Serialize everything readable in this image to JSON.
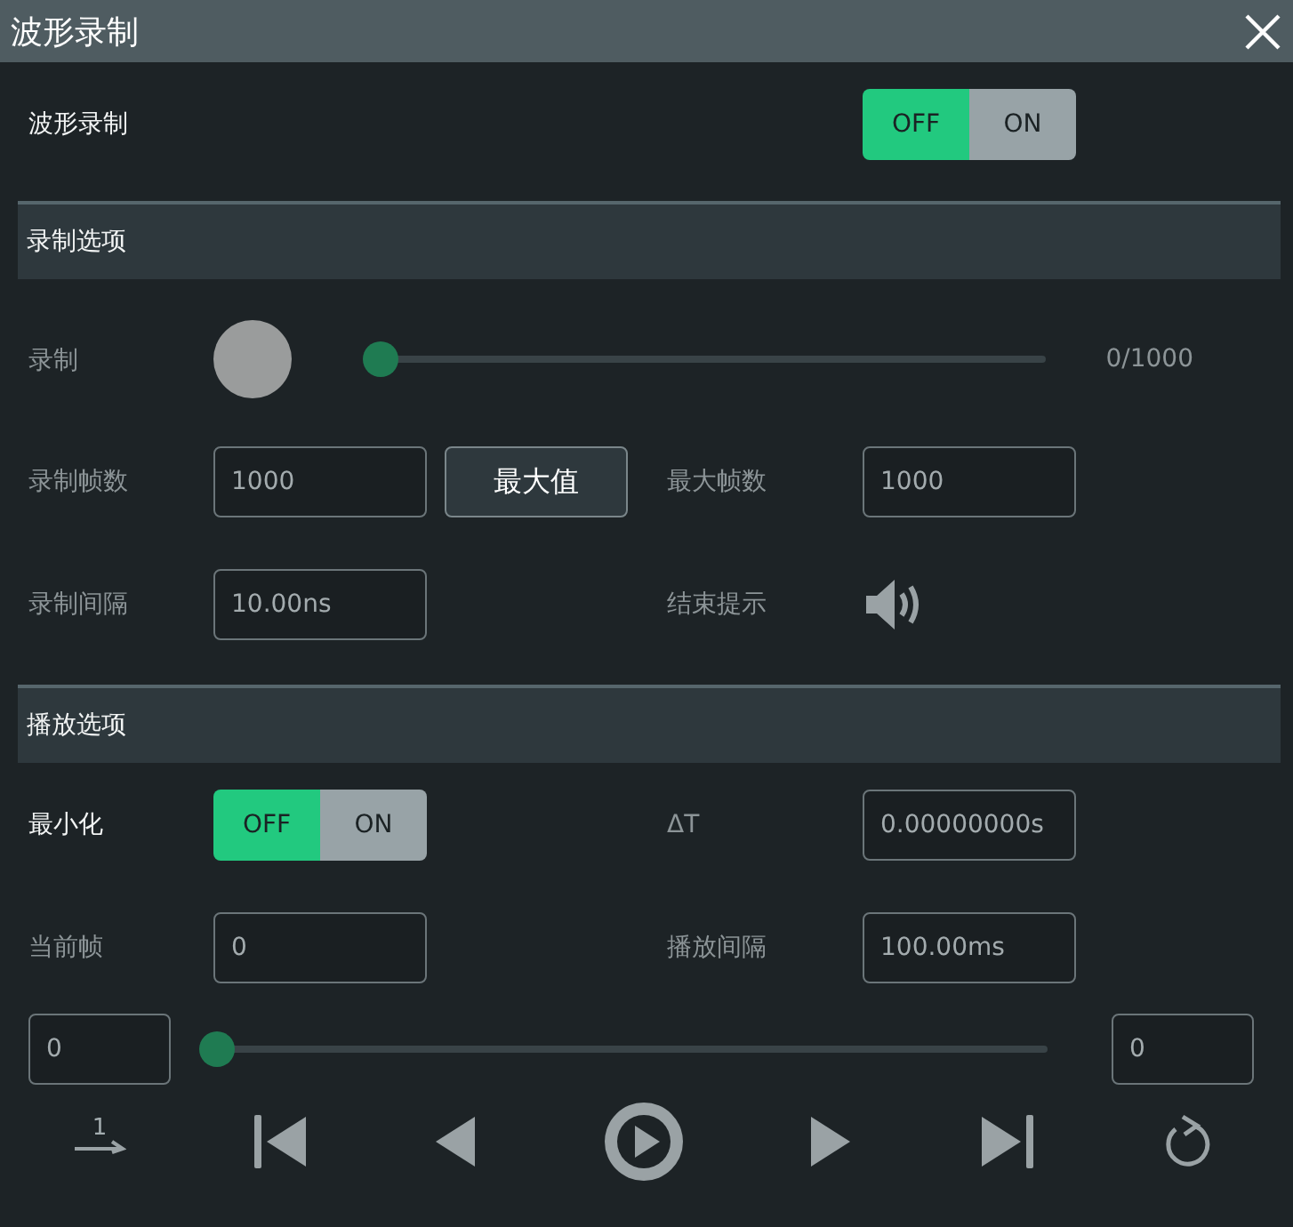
{
  "window": {
    "title": "波形录制"
  },
  "record_switch": {
    "label": "波形录制",
    "disabled": false,
    "on": false,
    "off_text": "OFF",
    "on_text": "ON"
  },
  "record_section": {
    "title": "录制选项",
    "record": {
      "label": "录制",
      "disabled": true,
      "level": 0,
      "reading": "0/1000"
    },
    "frames": {
      "label": "录制帧数",
      "disabled": true,
      "value": "1000"
    },
    "max_button": "最大值",
    "max_frames": {
      "label": "最大帧数",
      "disabled": true,
      "value": "1000"
    },
    "interval": {
      "label": "录制间隔",
      "disabled": true,
      "value": "10.00ns"
    },
    "end_prompt": {
      "label": "结束提示",
      "disabled": true
    }
  },
  "play_section": {
    "title": "播放选项",
    "minimize": {
      "label": "最小化",
      "disabled": false,
      "on": false,
      "off_text": "OFF",
      "on_text": "ON"
    },
    "delta_t": {
      "label": "ΔT",
      "disabled": true,
      "value": "0.00000000s"
    },
    "current_frame": {
      "label": "当前帧",
      "disabled": true,
      "value": "0"
    },
    "play_interval": {
      "label": "播放间隔",
      "disabled": true,
      "value": "100.00ms"
    },
    "range_start": "0",
    "range_end": "0",
    "level": 0,
    "controls": [
      {
        "kind": "once",
        "text": "1"
      },
      {
        "kind": "first"
      },
      {
        "kind": "prev"
      },
      {
        "kind": "play"
      },
      {
        "kind": "next"
      },
      {
        "kind": "last"
      },
      {
        "kind": "loop"
      }
    ]
  }
}
